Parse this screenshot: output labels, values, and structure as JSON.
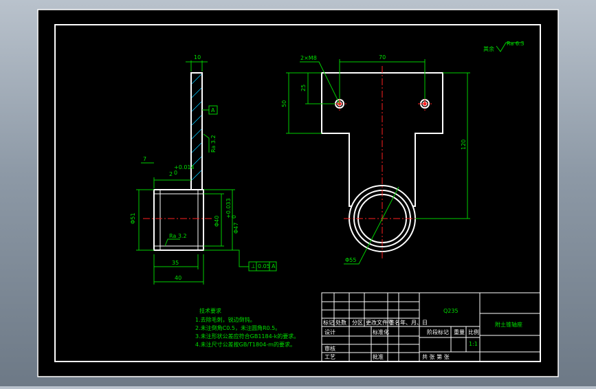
{
  "drawing": {
    "part_name": "附土锥轴座",
    "material": "Q235",
    "scale": "1:1",
    "roughness_note": "其余",
    "roughness_other": "Ra 6.3",
    "roughness_face": "Ra 3.2",
    "roughness_bore": "Ra 3.2"
  },
  "side_view": {
    "dim_width_top": "10",
    "dim_groove": "7",
    "dim_tol_depth": "2",
    "dim_tol_upper": "+0.014",
    "dim_tol_lower": "0",
    "dim_bore": "Φ40",
    "dim_outer": "Φ51",
    "dim_fit": "Φ47",
    "dim_fit_upper": "+0.033",
    "dim_fit_lower": "0",
    "dim_len_inner": "35",
    "dim_len_outer": "40",
    "datum_label": "A",
    "ref_datum": "A",
    "perp_tol": "0.05"
  },
  "front_view": {
    "dim_holes": "2×M8",
    "dim_hole_spacing": "70",
    "dim_hole_height": "25",
    "dim_flange_height": "50",
    "dim_total_height": "120",
    "dim_circle": "Φ55"
  },
  "notes": {
    "title": "技术要求",
    "lines": [
      "1.去除毛刺，锐边倒钝。",
      "2.未注倒角C0.5，未注圆角R0.5。",
      "3.未注形状公差应符合GB1184-k的要求。",
      "4.未注尺寸公差按GB/T1804-m的要求。"
    ]
  },
  "title_block": {
    "row_labels": [
      "标记",
      "处数",
      "分区",
      "更改文件号",
      "签名",
      "年、月、日"
    ],
    "designer": "设计",
    "standardize": "标准化",
    "checker": "审核",
    "process": "工艺",
    "approve": "批准",
    "stage_mark": "阶段标记",
    "weight": "重量",
    "scale_label": "比例",
    "sheets": "共  张  第  张"
  }
}
